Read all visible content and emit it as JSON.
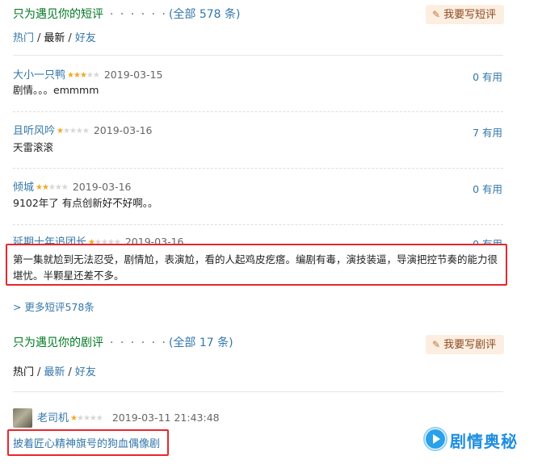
{
  "short_reviews": {
    "title": "只为遇见你的短评",
    "dots": "· · · · · ·",
    "count_label": "(全部 578 条)",
    "write_label": "我要写短评",
    "tabs": [
      "热门",
      "最新",
      "好友"
    ],
    "items": [
      {
        "author": "大小一只鸭",
        "rating_stars": 3,
        "date": "2019-03-15",
        "useful": "0 有用",
        "text": "剧情。。。emmmm"
      },
      {
        "author": "且听风吟",
        "rating_stars": 1,
        "date": "2019-03-16",
        "useful": "7 有用",
        "text": "天雷滚滚"
      },
      {
        "author": "倾城",
        "rating_stars": 2,
        "date": "2019-03-16",
        "useful": "0 有用",
        "text": "9102年了 有点创新好不好啊。。"
      },
      {
        "author": "延期十年追团长",
        "rating_stars": 1,
        "date": "2019-03-16",
        "useful": "0 有用",
        "text": "第一集就尬到无法忍受，剧情尬，表演尬，看的人起鸡皮疙瘩。编剧有毒，演技装逼，导演把控节奏的能力很堪忧。半颗星还差不多。"
      }
    ],
    "more_label": "> 更多短评578条"
  },
  "long_reviews": {
    "title": "只为遇见你的剧评",
    "dots": "· · · · · ·",
    "count_label": "(全部 17 条)",
    "write_label": "我要写剧评",
    "tabs": [
      "热门",
      "最新",
      "好友"
    ],
    "items": [
      {
        "author": "老司机",
        "rating_stars": 1,
        "datetime": "2019-03-11 21:43:48",
        "title": "披着匠心精神旗号的狗血偶像剧"
      }
    ]
  },
  "watermark": {
    "text": "剧情奥秘",
    "icon": "play-logo-icon"
  },
  "colors": {
    "link": "#3377aa",
    "section_title": "#007722",
    "highlight": "#e8262e",
    "star": "#f5a623"
  }
}
